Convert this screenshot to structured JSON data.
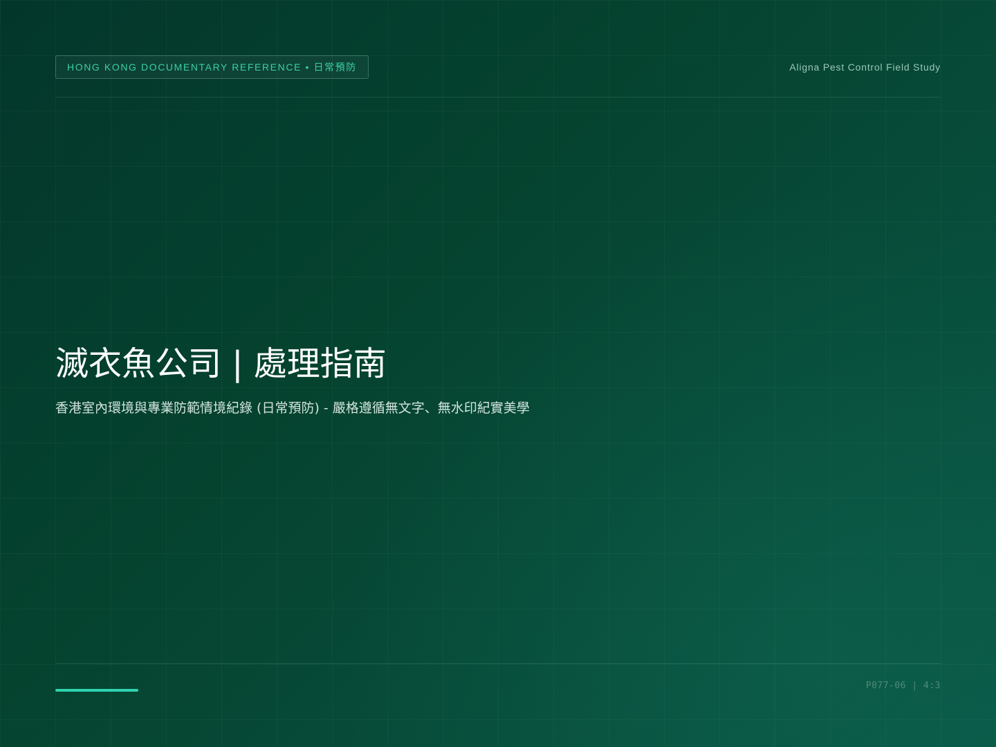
{
  "header": {
    "badge": "HONG KONG DOCUMENTARY REFERENCE • 日常預防",
    "right_text": "Aligna Pest Control Field Study"
  },
  "main": {
    "title": "滅衣魚公司 | 處理指南",
    "subtitle": "香港室內環境與專業防範情境紀錄 (日常預防) - 嚴格遵循無文字、無水印紀實美學"
  },
  "footer": {
    "code": "P077-06 | 4:3"
  },
  "colors": {
    "background": "#04402f",
    "accent": "#2fd3b0",
    "badge_text": "#3ccfa8"
  }
}
